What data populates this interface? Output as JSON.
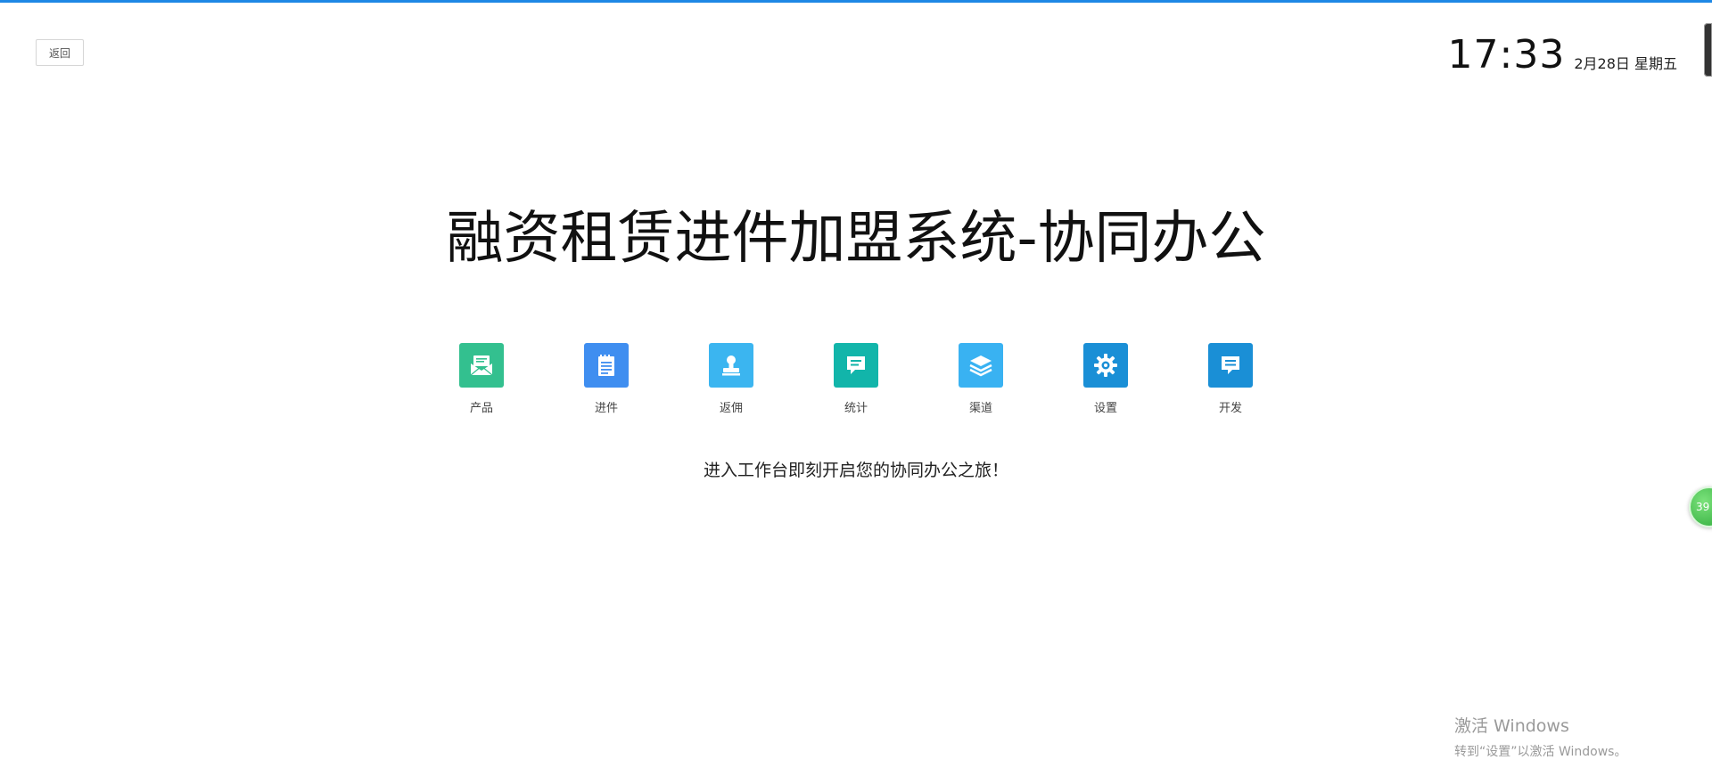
{
  "header": {
    "back_label": "返回",
    "time": "17:33",
    "date": "2月28日 星期五"
  },
  "main": {
    "title": "融资租赁进件加盟系统-协同办公",
    "subtitle": "进入工作台即刻开启您的协同办公之旅！",
    "apps": [
      {
        "label": "产品",
        "icon": "envelope-icon",
        "color": "#33c08f"
      },
      {
        "label": "进件",
        "icon": "notepad-icon",
        "color": "#3f8ef0"
      },
      {
        "label": "返佣",
        "icon": "stamp-icon",
        "color": "#3bb5f0"
      },
      {
        "label": "统计",
        "icon": "chat-icon",
        "color": "#12b5aa"
      },
      {
        "label": "渠道",
        "icon": "layers-icon",
        "color": "#39b2f2"
      },
      {
        "label": "设置",
        "icon": "gear-icon",
        "color": "#1a8fd6"
      },
      {
        "label": "开发",
        "icon": "message-icon",
        "color": "#1a8fd6"
      }
    ]
  },
  "floating_badge": {
    "text": "39"
  },
  "watermark": {
    "line1": "激活 Windows",
    "line2": "转到“设置”以激活 Windows。"
  }
}
